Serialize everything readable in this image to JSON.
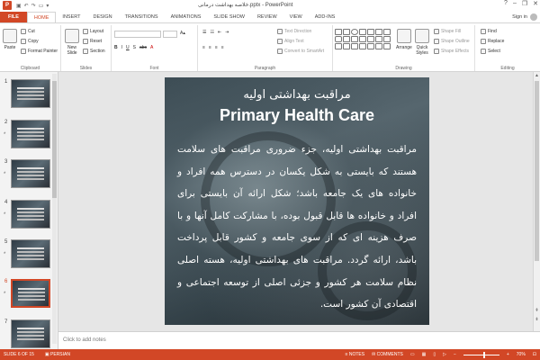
{
  "window": {
    "title": "خلاصه بهداشت درمانی.pptx - PowerPoint",
    "help": "?",
    "minimize": "–",
    "restore": "❐",
    "close": "✕"
  },
  "tabs": [
    {
      "label": "FILE"
    },
    {
      "label": "HOME"
    },
    {
      "label": "INSERT"
    },
    {
      "label": "DESIGN"
    },
    {
      "label": "TRANSITIONS"
    },
    {
      "label": "ANIMATIONS"
    },
    {
      "label": "SLIDE SHOW"
    },
    {
      "label": "REVIEW"
    },
    {
      "label": "VIEW"
    },
    {
      "label": "ADD-INS"
    }
  ],
  "account": {
    "signin": "Sign in"
  },
  "ribbon": {
    "clipboard": {
      "label": "Clipboard",
      "paste": "Paste",
      "cut": "Cut",
      "copy": "Copy",
      "format_painter": "Format Painter"
    },
    "slides": {
      "label": "Slides",
      "new_slide": "New Slide",
      "layout": "Layout",
      "reset": "Reset",
      "section": "Section"
    },
    "font": {
      "label": "Font"
    },
    "paragraph": {
      "label": "Paragraph",
      "text_direction": "Text Direction",
      "align_text": "Align Text",
      "convert_smartart": "Convert to SmartArt"
    },
    "drawing": {
      "label": "Drawing",
      "arrange": "Arrange",
      "quick_styles": "Quick Styles",
      "shape_fill": "Shape Fill",
      "shape_outline": "Shape Outline",
      "shape_effects": "Shape Effects"
    },
    "editing": {
      "label": "Editing",
      "find": "Find",
      "replace": "Replace",
      "select": "Select"
    }
  },
  "thumbnails": [
    {
      "num": "1",
      "star": ""
    },
    {
      "num": "2",
      "star": "*"
    },
    {
      "num": "3",
      "star": "*"
    },
    {
      "num": "4",
      "star": "*"
    },
    {
      "num": "5",
      "star": "*"
    },
    {
      "num": "6",
      "star": "*"
    },
    {
      "num": "7",
      "star": ""
    }
  ],
  "slide": {
    "title_fa": "مراقبت بهداشتی اولیه",
    "title_en": "Primary Health Care",
    "body": "مراقبت بهداشتی اولیه، جزء ضروری مراقبت های سلامت هستند که بایستی به شکل یکسان در دسترس همه افراد و خانواده های یک جامعه باشد؛ شکل ارائه آن بایستی برای افراد و خانواده ها قابل قبول بوده، با مشارکت کامل آنها و با صرف هزینه ای که از سوی جامعه و کشور قابل پرداخت باشد، ارائه گردد. مراقبت های بهداشتی اولیه، هسته اصلی نظام سلامت هر کشور و جزئی اصلی از توسعه اجتماعی و اقتصادی آن کشور است."
  },
  "notes": {
    "placeholder": "Click to add notes"
  },
  "status": {
    "slide_info": "SLIDE 6 OF 15",
    "language": "PERSIAN",
    "notes": "NOTES",
    "comments": "COMMENTS",
    "zoom": "70%"
  }
}
